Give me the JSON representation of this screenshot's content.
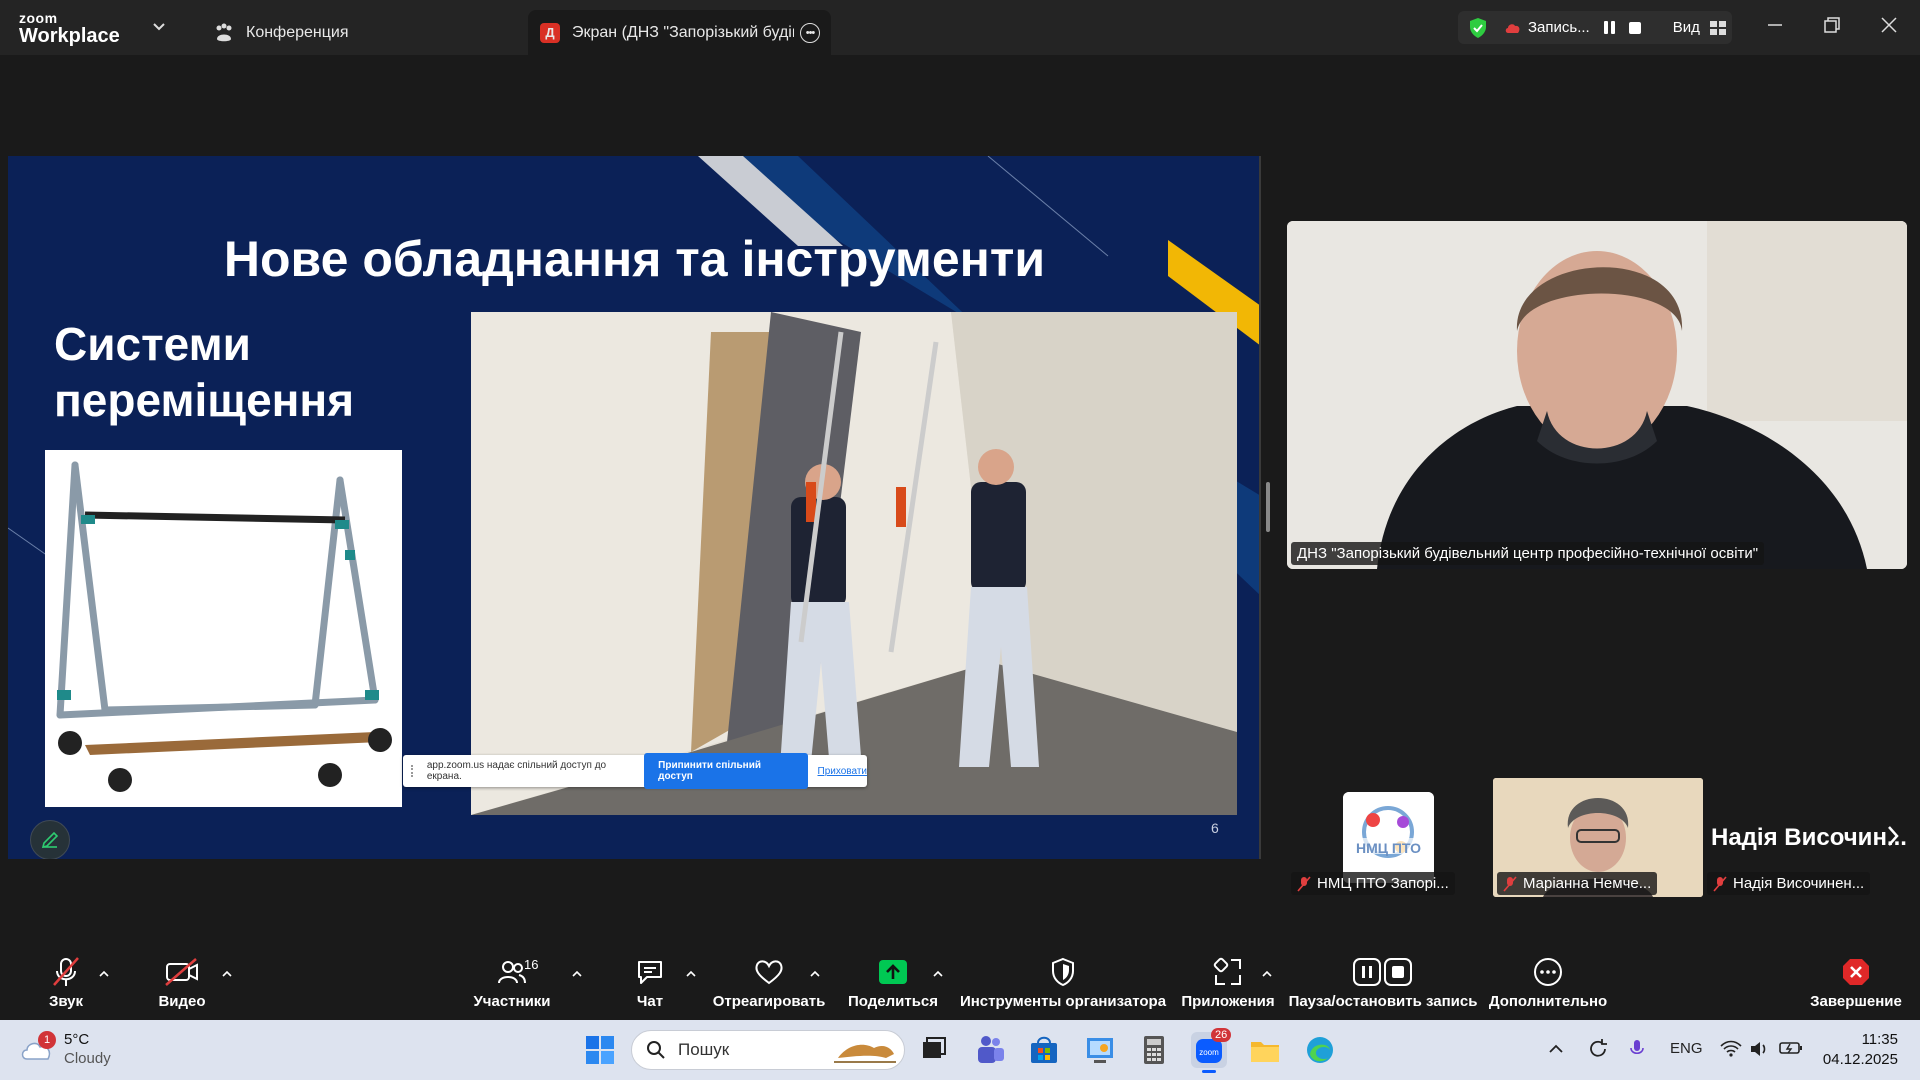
{
  "titlebar": {
    "logo_top": "zoom",
    "logo_bottom": "Workplace",
    "tab_conference": "Конференция",
    "tab_screen_badge": "Д",
    "tab_screen_label": "Экран (ДНЗ \"Запорізький будівельний центр професійно-технічної освіти\")",
    "recording_label": "Запись...",
    "view_label": "Вид"
  },
  "slide": {
    "title": "Нове обладнання та інструменти",
    "subtitle_line1": "Системи",
    "subtitle_line2": "переміщення",
    "page_number": "6"
  },
  "share_bar": {
    "message": "app.zoom.us надає спільний доступ до екрана.",
    "stop_button": "Припинити спільний доступ",
    "hide_link": "Приховати"
  },
  "speaker": {
    "name": "ДНЗ \"Запорізький будівельний центр професійно-технічної освіти\""
  },
  "thumbnails": [
    {
      "name": "НМЦ ПТО Запорі...",
      "logo_text": "НМЦ ПТО"
    },
    {
      "name": "Маріанна Немче..."
    },
    {
      "name": "Надія Височинен...",
      "display_name": "Надія Височин..."
    }
  ],
  "toolbar": {
    "audio": "Звук",
    "video": "Видео",
    "participants": "Участники",
    "participants_count": "16",
    "chat": "Чат",
    "react": "Отреагировать",
    "share": "Поделиться",
    "host_tools": "Инструменты организатора",
    "apps": "Приложения",
    "pause_stop_record": "Пауза/остановить запись",
    "more": "Дополнительно",
    "end": "Завершение"
  },
  "taskbar": {
    "weather_temp": "5°C",
    "weather_cond": "Cloudy",
    "weather_badge": "1",
    "search_placeholder": "Пошук",
    "zoom_badge": "26",
    "lang": "ENG",
    "time": "11:35",
    "date": "04.12.2025"
  },
  "colors": {
    "slide_bg": "#0b2157",
    "accent_yellow": "#f2b705",
    "zoom_green": "#00c853",
    "end_red": "#e02828"
  }
}
